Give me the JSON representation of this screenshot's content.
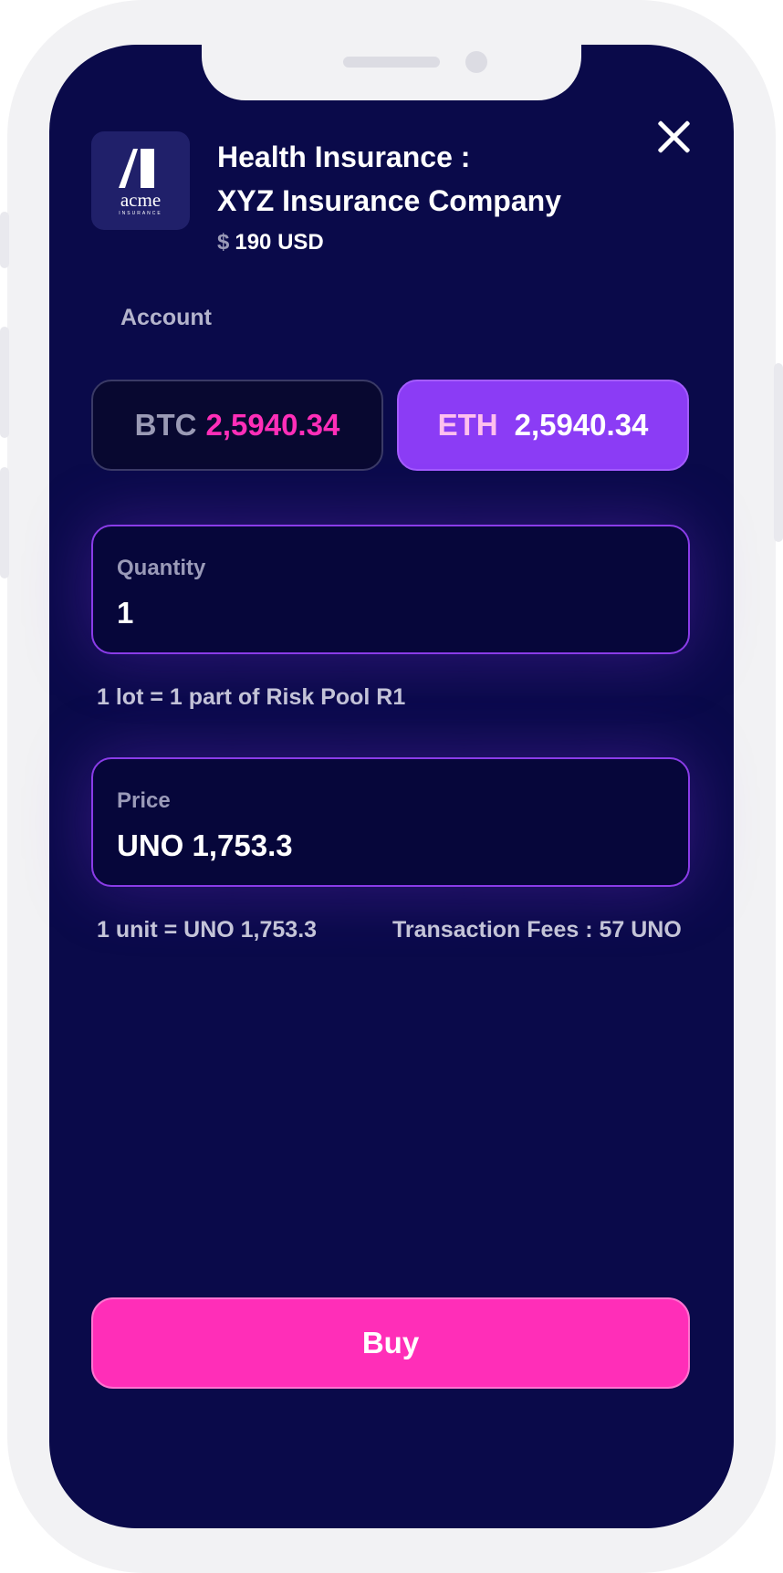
{
  "product": {
    "logo": {
      "word": "acme",
      "sub": "INSURANCE"
    },
    "title_line1": "Health Insurance :",
    "title_line2": "XYZ Insurance Company",
    "currency_symbol": "$",
    "price": "190 USD"
  },
  "account": {
    "label": "Account",
    "options": [
      {
        "currency": "BTC",
        "balance": "2,5940.34",
        "selected": false
      },
      {
        "currency": "ETH",
        "balance": "2,5940.34",
        "selected": true
      }
    ]
  },
  "quantity": {
    "label": "Quantity",
    "value": "1",
    "note": "1 lot = 1 part of Risk Pool R1"
  },
  "price_field": {
    "label": "Price",
    "value": "UNO 1,753.3",
    "unit_note": "1 unit = UNO 1,753.3",
    "fees_note": "Transaction Fees : 57 UNO"
  },
  "buy_label": "Buy",
  "icons": {
    "close": "close-icon",
    "logo": "acme-logo-icon"
  },
  "colors": {
    "background": "#0a0a4a",
    "accent": "#ff2eb8",
    "selected": "#8b3cf5",
    "border": "#8a3ce8"
  }
}
